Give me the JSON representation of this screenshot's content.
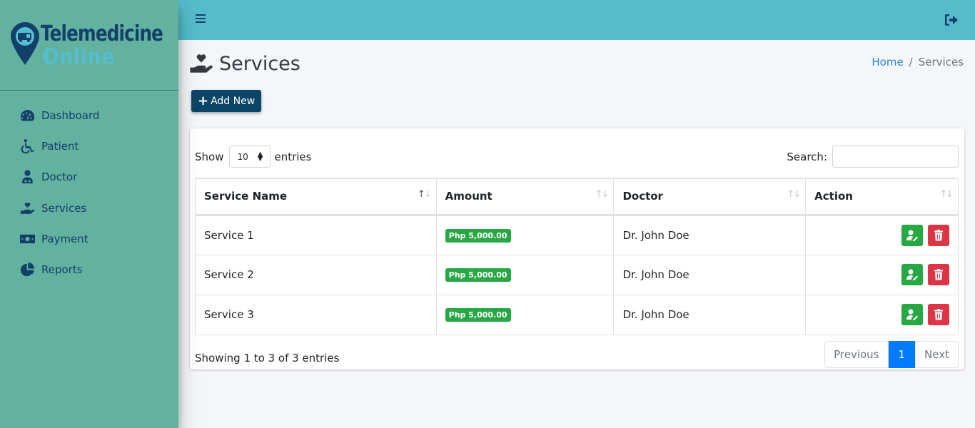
{
  "brand": {
    "line1": "Telemedicine",
    "line2": "Online"
  },
  "sidebar": {
    "items": [
      {
        "label": "Dashboard",
        "icon": "tachometer-icon"
      },
      {
        "label": "Patient",
        "icon": "wheelchair-icon"
      },
      {
        "label": "Doctor",
        "icon": "doctor-icon"
      },
      {
        "label": "Services",
        "icon": "hand-holding-heart-icon"
      },
      {
        "label": "Payment",
        "icon": "money-bill-icon"
      },
      {
        "label": "Reports",
        "icon": "chart-pie-icon"
      }
    ]
  },
  "topbar": {
    "menu_icon": "hamburger-icon",
    "logout_icon": "sign-out-icon"
  },
  "page": {
    "title": "Services",
    "icon": "hand-holding-heart-icon"
  },
  "breadcrumb": {
    "home": "Home",
    "separator": "/",
    "current": "Services"
  },
  "toolbar": {
    "add_label": "Add New"
  },
  "table_controls": {
    "show_label": "Show",
    "entries_label": "entries",
    "page_length": "10",
    "search_label": "Search:",
    "search_value": ""
  },
  "table": {
    "columns": [
      "Service Name",
      "Amount",
      "Doctor",
      "Action"
    ],
    "rows": [
      {
        "service": "Service 1",
        "amount": "Php 5,000.00",
        "doctor": "Dr. John Doe"
      },
      {
        "service": "Service 2",
        "amount": "Php 5,000.00",
        "doctor": "Dr. John Doe"
      },
      {
        "service": "Service 3",
        "amount": "Php 5,000.00",
        "doctor": "Dr. John Doe"
      }
    ]
  },
  "footer": {
    "info": "Showing 1 to 3 of 3 entries",
    "previous": "Previous",
    "current_page": "1",
    "next": "Next"
  },
  "colors": {
    "sidebar_bg": "#62b29f",
    "topbar_bg": "#56bccb",
    "brand_dark": "#12406a",
    "brand_light": "#55bfcf",
    "primary": "#007bff",
    "success": "#28a745",
    "danger": "#dc3545",
    "add_button": "#0d4566"
  }
}
